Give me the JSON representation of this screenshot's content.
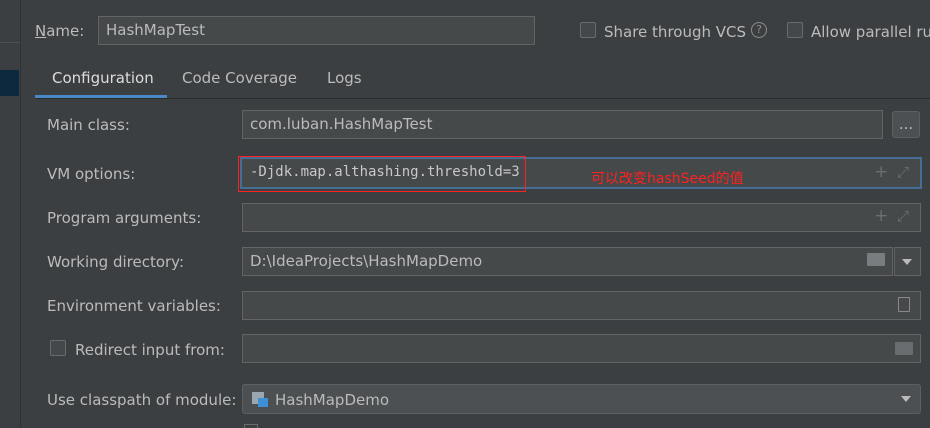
{
  "header": {
    "name_label": "Name:",
    "name_value": "HashMapTest",
    "share_label": "Share through VCS",
    "help_glyph": "?",
    "parallel_label": "Allow parallel ru"
  },
  "tabs": [
    {
      "label": "Configuration",
      "active": true
    },
    {
      "label": "Code Coverage",
      "active": false
    },
    {
      "label": "Logs",
      "active": false
    }
  ],
  "form": {
    "main_class_label": "Main class:",
    "main_class_value": "com.luban.HashMapTest",
    "browse_label": "...",
    "vm_options_label": "VM options:",
    "vm_options_value": "-Djdk.map.althashing.threshold=3",
    "vm_annotation": "可以改变hashSeed的值",
    "program_args_label": "Program arguments:",
    "program_args_value": "",
    "working_dir_label": "Working directory:",
    "working_dir_value": "D:\\IdeaProjects\\HashMapDemo",
    "env_vars_label": "Environment variables:",
    "env_vars_value": "",
    "redirect_label": "Redirect input from:",
    "redirect_value": "",
    "classpath_label": "Use classpath of module:",
    "classpath_value": "HashMapDemo"
  },
  "icons": {
    "expand": "plus-icon",
    "fullscreen": "expand-arrows-icon",
    "folder": "folder-icon",
    "dropdown": "chevron-down-icon",
    "document": "document-icon",
    "module": "module-icon"
  },
  "colors": {
    "background": "#3c3f41",
    "field": "#45494a",
    "focus_border": "#4a88c7",
    "annotation_red": "#ff2020",
    "tab_accent": "#4a88c7"
  }
}
